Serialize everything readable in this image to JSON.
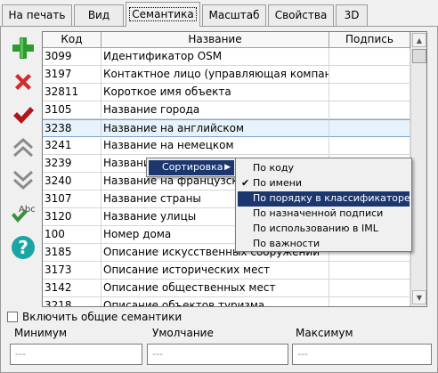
{
  "tabs": [
    {
      "label": "На печать",
      "active": false
    },
    {
      "label": "Вид",
      "active": false
    },
    {
      "label": "Семантика",
      "active": true
    },
    {
      "label": "Масштаб",
      "active": false
    },
    {
      "label": "Свойства",
      "active": false
    },
    {
      "label": "3D",
      "active": false
    }
  ],
  "toolbar": {
    "add_icon": "plus-icon",
    "delete_icon": "x-icon",
    "apply_icon": "checkmark-icon",
    "move_up_icon": "double-chevron-up-icon",
    "move_down_icon": "double-chevron-down-icon",
    "spellcheck_icon": "abc-check-icon",
    "help_icon": "question-icon",
    "colors": {
      "add": "#2e9b2e",
      "delete": "#d12b2b",
      "apply": "#b0161a",
      "help": "#1aa5a5"
    }
  },
  "table": {
    "columns": [
      "Код",
      "Название",
      "Подпись"
    ],
    "rows": [
      {
        "code": "3099",
        "name": "Идентификатор OSM",
        "sign": ""
      },
      {
        "code": "3197",
        "name": "Контактное лицо (управляющая компания)",
        "sign": ""
      },
      {
        "code": "32811",
        "name": "Короткое имя объекта",
        "sign": ""
      },
      {
        "code": "3105",
        "name": "Название города",
        "sign": ""
      },
      {
        "code": "3238",
        "name": "Название на английском",
        "sign": ""
      },
      {
        "code": "3241",
        "name": "Название на немецком",
        "sign": ""
      },
      {
        "code": "3239",
        "name": "Название на испанском",
        "sign": ""
      },
      {
        "code": "3240",
        "name": "Название на французском",
        "sign": ""
      },
      {
        "code": "3107",
        "name": "Название страны",
        "sign": ""
      },
      {
        "code": "3120",
        "name": "Название улицы",
        "sign": ""
      },
      {
        "code": "100",
        "name": "Номер дома",
        "sign": ""
      },
      {
        "code": "3185",
        "name": "Описание искусственных сооружений",
        "sign": ""
      },
      {
        "code": "3173",
        "name": "Описание исторических мест",
        "sign": ""
      },
      {
        "code": "3142",
        "name": "Описание общественных мест",
        "sign": ""
      },
      {
        "code": "3218",
        "name": "Описание объектов туризма",
        "sign": ""
      }
    ],
    "selected_row": 4
  },
  "context_menu": {
    "item": "Сортировка",
    "submenu": [
      {
        "label": "По коду",
        "checked": false,
        "highlighted": false
      },
      {
        "label": "По имени",
        "checked": true,
        "highlighted": false
      },
      {
        "label": "По порядку в классификаторе",
        "checked": false,
        "highlighted": true
      },
      {
        "label": "По назначенной подписи",
        "checked": false,
        "highlighted": false
      },
      {
        "label": "По использованию в IML",
        "checked": false,
        "highlighted": false
      },
      {
        "label": "По важности",
        "checked": false,
        "highlighted": false
      }
    ]
  },
  "bottom": {
    "include_common_label": "Включить общие семантики",
    "min_label": "Минимум",
    "default_label": "Умолчание",
    "max_label": "Максимум",
    "min_value": "---",
    "default_value": "---",
    "max_value": "---"
  }
}
